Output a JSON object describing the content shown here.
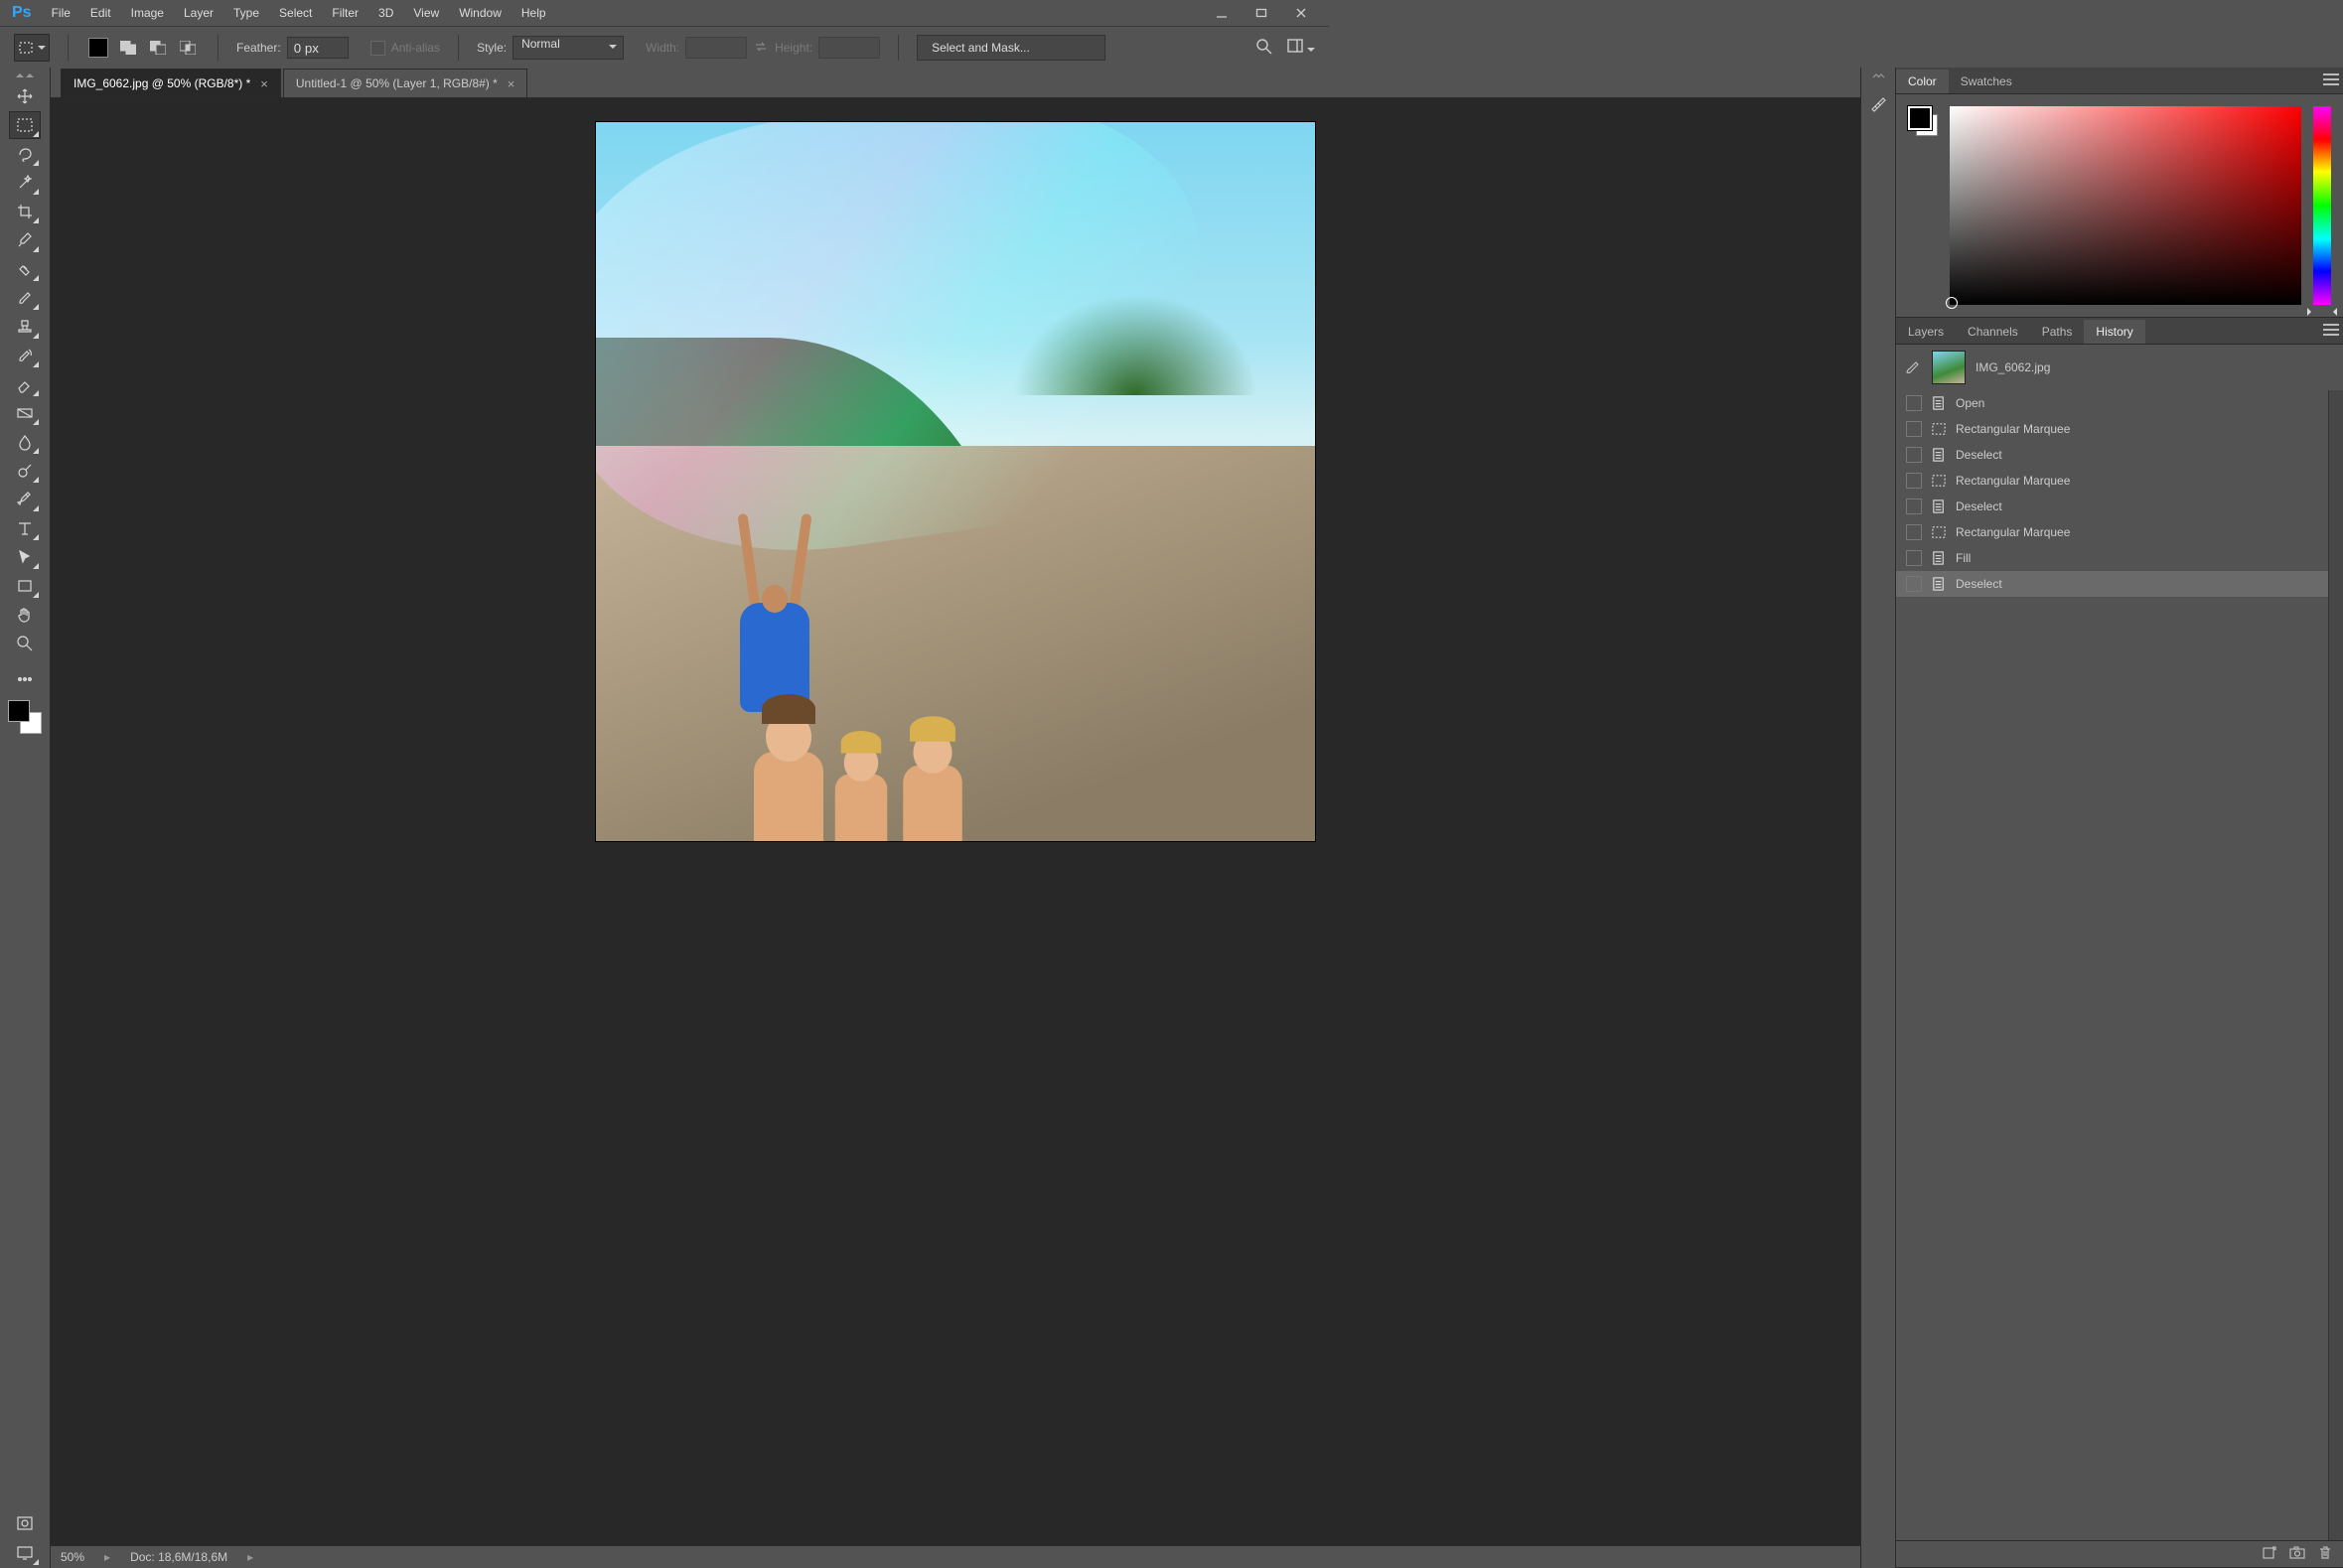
{
  "app": {
    "logo": "Ps"
  },
  "menubar": [
    "File",
    "Edit",
    "Image",
    "Layer",
    "Type",
    "Select",
    "Filter",
    "3D",
    "View",
    "Window",
    "Help"
  ],
  "options": {
    "feather_label": "Feather:",
    "feather_value": "0 px",
    "antialias_label": "Anti-alias",
    "style_label": "Style:",
    "style_value": "Normal",
    "width_label": "Width:",
    "height_label": "Height:",
    "select_mask_label": "Select and Mask..."
  },
  "tabs": [
    {
      "title": "IMG_6062.jpg @ 50% (RGB/8*) *",
      "active": true
    },
    {
      "title": "Untitled-1 @ 50% (Layer 1, RGB/8#) *",
      "active": false
    }
  ],
  "status": {
    "zoom": "50%",
    "doc": "Doc: 18,6M/18,6M"
  },
  "panels": {
    "color": {
      "tab_color": "Color",
      "tab_swatches": "Swatches"
    },
    "lower_tabs": {
      "layers": "Layers",
      "channels": "Channels",
      "paths": "Paths",
      "history": "History"
    },
    "history": {
      "doc_name": "IMG_6062.jpg",
      "rows": [
        {
          "icon": "doc",
          "label": "Open"
        },
        {
          "icon": "marquee",
          "label": "Rectangular Marquee"
        },
        {
          "icon": "doc",
          "label": "Deselect"
        },
        {
          "icon": "marquee",
          "label": "Rectangular Marquee"
        },
        {
          "icon": "doc",
          "label": "Deselect"
        },
        {
          "icon": "marquee",
          "label": "Rectangular Marquee"
        },
        {
          "icon": "doc",
          "label": "Fill"
        },
        {
          "icon": "doc",
          "label": "Deselect"
        }
      ],
      "selected_index": 7
    }
  },
  "tools": [
    "move",
    "marquee",
    "lasso",
    "wand",
    "crop",
    "eyedropper",
    "healing",
    "brush",
    "stamp",
    "history-brush",
    "eraser",
    "gradient",
    "blur",
    "dodge",
    "pen",
    "type",
    "path-select",
    "shape",
    "hand",
    "zoom"
  ]
}
